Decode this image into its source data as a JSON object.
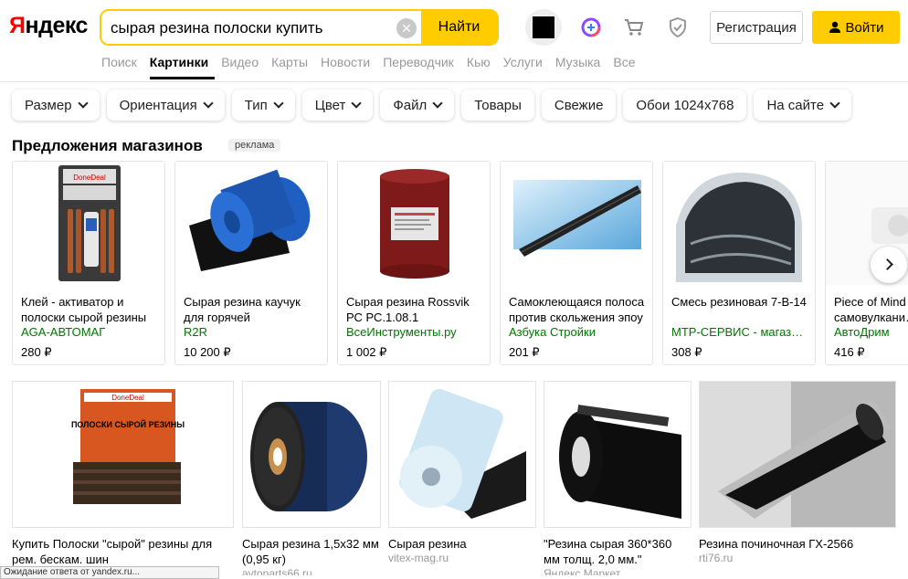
{
  "logo": {
    "first": "Я",
    "rest": "ндекс"
  },
  "search": {
    "value": "сырая резина полоски купить",
    "find_label": "Найти"
  },
  "header": {
    "register_label": "Регистрация",
    "login_label": "Войти"
  },
  "tabs": [
    {
      "label": "Поиск"
    },
    {
      "label": "Картинки"
    },
    {
      "label": "Видео"
    },
    {
      "label": "Карты"
    },
    {
      "label": "Новости"
    },
    {
      "label": "Переводчик"
    },
    {
      "label": "Кью"
    },
    {
      "label": "Услуги"
    },
    {
      "label": "Музыка"
    },
    {
      "label": "Все"
    }
  ],
  "active_tab": "Картинки",
  "filters": [
    {
      "label": "Размер",
      "dropdown": true
    },
    {
      "label": "Ориентация",
      "dropdown": true
    },
    {
      "label": "Тип",
      "dropdown": true
    },
    {
      "label": "Цвет",
      "dropdown": true
    },
    {
      "label": "Файл",
      "dropdown": true
    },
    {
      "label": "Товары",
      "dropdown": false
    },
    {
      "label": "Свежие",
      "dropdown": false
    },
    {
      "label": "Обои 1024x768",
      "dropdown": false
    },
    {
      "label": "На сайте",
      "dropdown": true
    }
  ],
  "offers_section": {
    "title": "Предложения магазинов",
    "ad_label": "реклама"
  },
  "offers": [
    {
      "title": "Клей - активатор и полоски сырой резины",
      "shop": "AGA-АВТОМАГ",
      "price": "280 ₽"
    },
    {
      "title": "Сырая резина каучук для горячей",
      "shop": "R2R",
      "price": "10 200 ₽"
    },
    {
      "title": "Сырая резина Rossvik РС РС.1.08.1",
      "shop": "ВсеИнструменты.ру",
      "price": "1 002 ₽"
    },
    {
      "title": "Самоклеющаяся полоса против скольжения эпоу",
      "shop": "Азбука Стройки",
      "price": "201 ₽"
    },
    {
      "title": "Смесь резиновая 7-В-14",
      "shop": "МТР-СЕРВИС - магаз…",
      "price": "308 ₽"
    },
    {
      "title": "Piece of Mind самовулкани…",
      "shop": "АвтоДрим",
      "price": "416 ₽"
    }
  ],
  "results": [
    {
      "title": "Купить Полоски \"сырой\" резины для рем. бескам. шин",
      "source": ""
    },
    {
      "title": "Сырая резина 1,5x32 мм (0,95 кг)",
      "source": "avtoparts66.ru"
    },
    {
      "title": "Сырая резина",
      "source": "vitex-mag.ru"
    },
    {
      "title": "\"Резина сырая 360*360 мм толщ. 2,0 мм.\"",
      "source": "Яндекс.Маркет"
    },
    {
      "title": "Резина починочная ГХ-2566",
      "source": "rti76.ru"
    }
  ],
  "tooltip": "Ожидание ответа от yandex.ru...",
  "product_labels": {
    "doneDeal": "DoneDeal",
    "doneDeal_box": "ПОЛОСКИ СЫРОЙ РЕЗИНЫ"
  },
  "colors": {
    "accent": "#ffcc00",
    "logo_red": "#ff0000",
    "shop_green": "#007700",
    "muted": "#999999"
  }
}
